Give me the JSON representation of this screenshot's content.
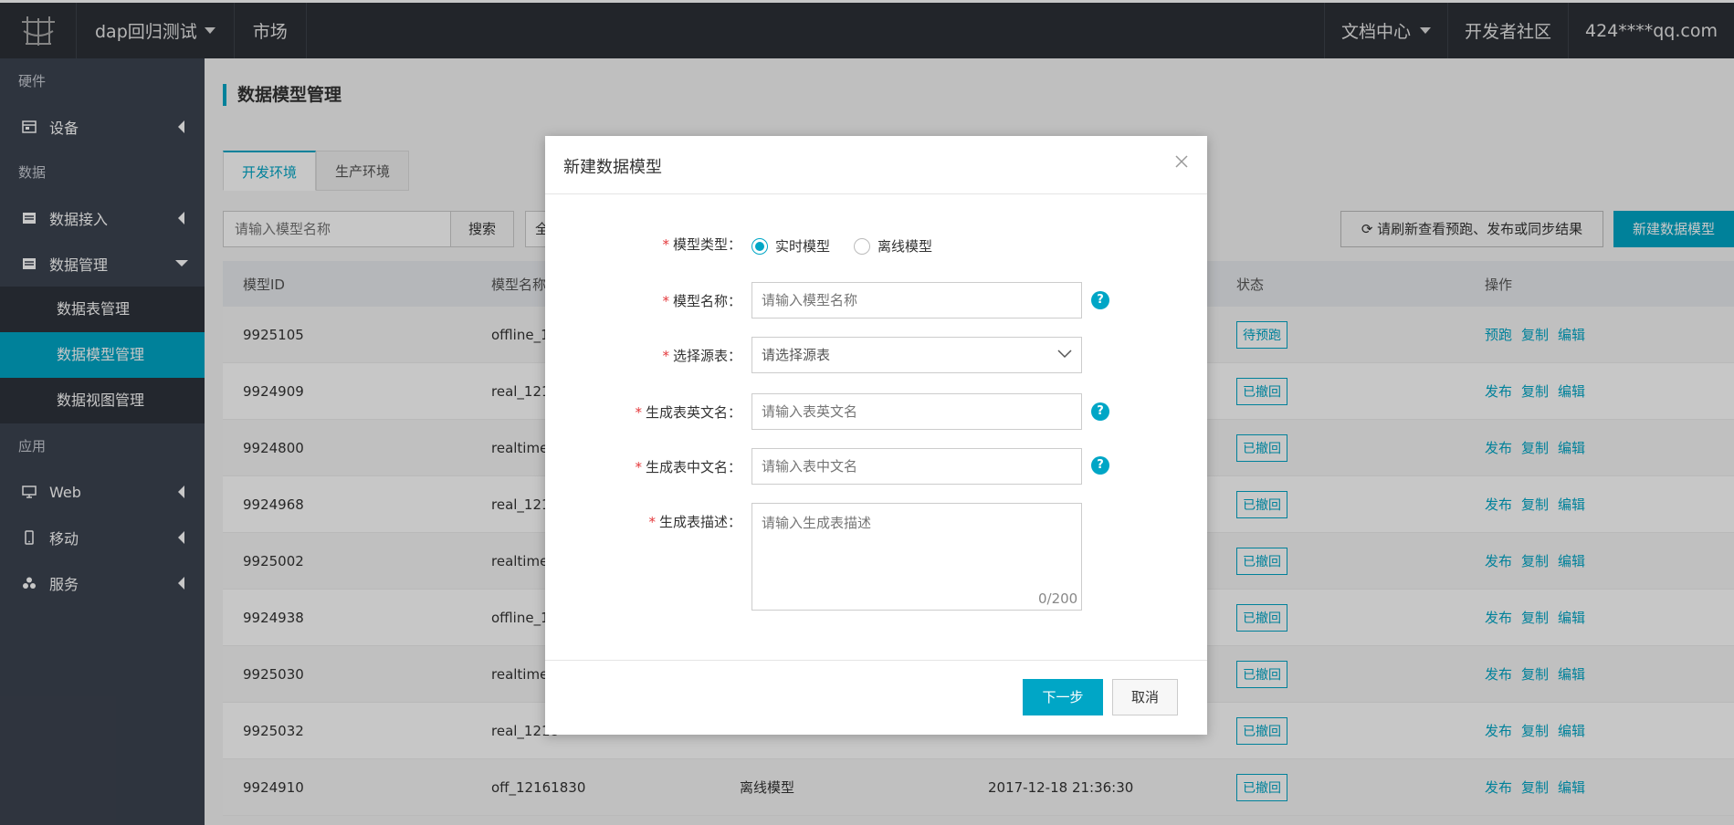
{
  "topbar": {
    "workspace": "dap回归测试",
    "market": "市场",
    "docs": "文档中心",
    "community": "开发者社区",
    "user": "424****qq.com"
  },
  "sidebar": {
    "group_hardware": "硬件",
    "item_device": "设备",
    "group_data": "数据",
    "item_data_access": "数据接入",
    "item_data_manage": "数据管理",
    "sub_table": "数据表管理",
    "sub_model": "数据模型管理",
    "sub_view": "数据视图管理",
    "group_app": "应用",
    "item_web": "Web",
    "item_mobile": "移动",
    "item_service": "服务"
  },
  "page": {
    "title": "数据模型管理",
    "tab_dev": "开发环境",
    "tab_prod": "生产环境",
    "search_placeholder": "请输入模型名称",
    "search_btn": "搜索",
    "filter_label": "全",
    "refresh_btn": "请刷新查看预跑、发布或同步结果",
    "new_btn": "新建数据模型"
  },
  "table": {
    "headers": [
      "模型ID",
      "模型名称",
      "",
      "",
      "状态",
      "操作"
    ],
    "rows": [
      {
        "id": "9925105",
        "name": "offline_12",
        "type": "",
        "time": "",
        "status": "待预跑",
        "ops": [
          "预跑",
          "复制",
          "编辑"
        ]
      },
      {
        "id": "9924909",
        "name": "real_1216",
        "type": "",
        "time": "",
        "status": "已撤回",
        "ops": [
          "发布",
          "复制",
          "编辑"
        ]
      },
      {
        "id": "9924800",
        "name": "realtime_",
        "type": "",
        "time": "",
        "status": "已撤回",
        "ops": [
          "发布",
          "复制",
          "编辑"
        ]
      },
      {
        "id": "9924968",
        "name": "real_1216",
        "type": "",
        "time": "",
        "status": "已撤回",
        "ops": [
          "发布",
          "复制",
          "编辑"
        ]
      },
      {
        "id": "9925002",
        "name": "realtime_",
        "type": "",
        "time": "",
        "status": "已撤回",
        "ops": [
          "发布",
          "复制",
          "编辑"
        ]
      },
      {
        "id": "9924938",
        "name": "offline_12",
        "type": "",
        "time": "",
        "status": "已撤回",
        "ops": [
          "发布",
          "复制",
          "编辑"
        ]
      },
      {
        "id": "9925030",
        "name": "realtime_",
        "type": "",
        "time": "",
        "status": "已撤回",
        "ops": [
          "发布",
          "复制",
          "编辑"
        ]
      },
      {
        "id": "9925032",
        "name": "real_1218",
        "type": "",
        "time": "",
        "status": "已撤回",
        "ops": [
          "发布",
          "复制",
          "编辑"
        ]
      },
      {
        "id": "9924910",
        "name": "off_12161830",
        "type": "离线模型",
        "time": "2017-12-18 21:36:30",
        "status": "已撤回",
        "ops": [
          "发布",
          "复制",
          "编辑"
        ]
      }
    ]
  },
  "modal": {
    "title": "新建数据模型",
    "type_label": "模型类型：",
    "type_realtime": "实时模型",
    "type_offline": "离线模型",
    "name_label": "模型名称：",
    "name_placeholder": "请输入模型名称",
    "source_label": "选择源表：",
    "source_placeholder": "请选择源表",
    "en_label": "生成表英文名：",
    "en_placeholder": "请输入表英文名",
    "cn_label": "生成表中文名：",
    "cn_placeholder": "请输入表中文名",
    "desc_label": "生成表描述：",
    "desc_placeholder": "请输入生成表描述",
    "counter": "0/200",
    "next_btn": "下一步",
    "cancel_btn": "取消",
    "required_mark": "*",
    "help_mark": "?"
  },
  "colors": {
    "accent": "#00a6c6",
    "topbar": "#2c3037",
    "sidebar": "#3c4350",
    "required": "#e4393c"
  }
}
